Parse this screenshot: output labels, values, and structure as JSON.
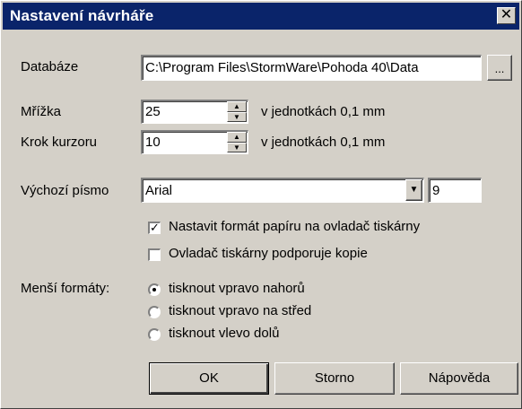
{
  "window": {
    "title": "Nastavení návrháře",
    "close_glyph": "✕"
  },
  "database": {
    "label": "Databáze",
    "value": "C:\\Program Files\\StormWare\\Pohoda 40\\Data",
    "browse_label": "..."
  },
  "grid": {
    "label": "Mřížka",
    "value": "25",
    "unit": "v jednotkách 0,1 mm"
  },
  "cursor_step": {
    "label": "Krok kurzoru",
    "value": "10",
    "unit": "v jednotkách 0,1 mm"
  },
  "default_font": {
    "label": "Výchozí písmo",
    "selected": "Arial",
    "size": "9"
  },
  "options": {
    "paper_format": {
      "label": "Nastavit formát papíru na ovladač tiskárny",
      "checked": true
    },
    "copies": {
      "label": "Ovladač tiskárny podporuje kopie",
      "checked": false
    }
  },
  "smaller_formats": {
    "label": "Menší formáty:",
    "choices": [
      {
        "label": "tisknout vpravo nahorů",
        "selected": true
      },
      {
        "label": "tisknout vpravo na střed",
        "selected": false
      },
      {
        "label": "tisknout vlevo dolů",
        "selected": false
      }
    ]
  },
  "buttons": {
    "ok": "OK",
    "cancel": "Storno",
    "help": "Nápověda"
  },
  "colors": {
    "titlebar": "#0a246a",
    "face": "#d4d0c8"
  }
}
